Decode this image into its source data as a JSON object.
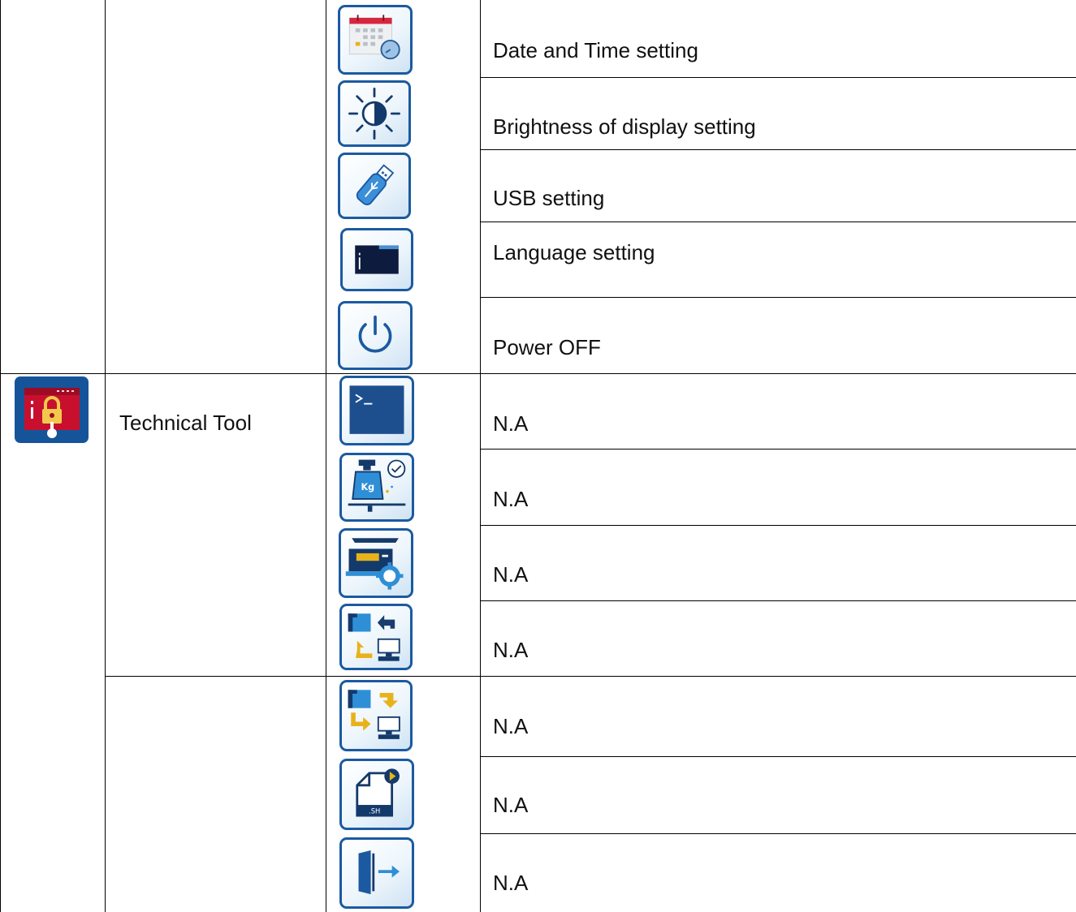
{
  "category": {
    "name": "Technical Tool",
    "icon": "technical-tool-lock-icon"
  },
  "settings_rows": [
    {
      "label": "Date and Time setting",
      "icon": "calendar-clock-icon"
    },
    {
      "label": "Brightness of display setting",
      "icon": "brightness-icon"
    },
    {
      "label": "USB setting",
      "icon": "usb-drive-icon"
    },
    {
      "label": "Language setting",
      "icon": "language-folder-icon"
    },
    {
      "label": "Power OFF",
      "icon": "power-icon"
    }
  ],
  "tool_rows": [
    {
      "label": "N.A",
      "icon": "terminal-icon"
    },
    {
      "label": "N.A",
      "icon": "weight-calibration-icon"
    },
    {
      "label": "N.A",
      "icon": "scale-settings-icon"
    },
    {
      "label": "N.A",
      "icon": "data-import-icon"
    },
    {
      "label": "N.A",
      "icon": "data-export-icon"
    },
    {
      "label": "N.A",
      "icon": "run-script-icon"
    },
    {
      "label": "N.A",
      "icon": "exit-icon"
    }
  ],
  "colors": {
    "tile_border": "#1b5aa0",
    "tile_navy": "#143a6b",
    "accent_yellow": "#e8b21a",
    "accent_blue": "#2f8fd6",
    "tool_icon_red": "#c8102e"
  }
}
